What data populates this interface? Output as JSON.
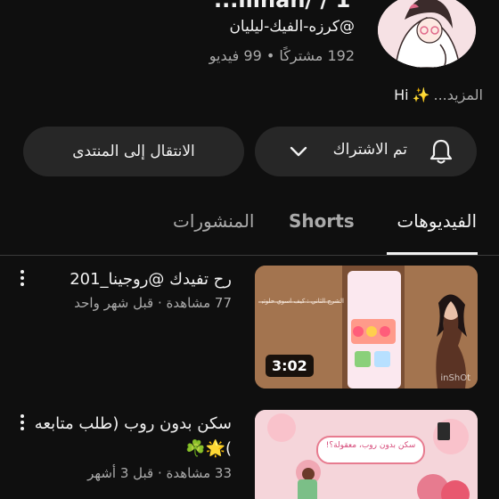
{
  "channel": {
    "name_clipped": "...iiinan/ / 1",
    "handle": "@كرزه-الفيك-ليليان",
    "stats": "192 مشتركًا • 99 فيديو",
    "description_text": "Hi",
    "description_emoji": "✨",
    "description_more": "المزيد..."
  },
  "buttons": {
    "subscribed_label": "تم الاشتراك",
    "forum_label": "الانتقال إلى المنتدى"
  },
  "tabs": {
    "videos": "الفيديوهات",
    "shorts": "Shorts",
    "posts": "المنشورات"
  },
  "videos": [
    {
      "title": "رح تفيدك @روجينا_201",
      "meta": "77 مشاهدة · قبل شهر واحد",
      "duration": "3:02",
      "thumb_caption": "الشرح الثاني : كيف اسوي حلوتي",
      "thumb_watermark": "inShOt"
    },
    {
      "title": "سكن بدون روب (طلب متابعه )🌟☘️",
      "meta": "33 مشاهدة · قبل 3 أشهر",
      "thumb_caption": "سكن بدون روب، معقولة؟!"
    }
  ],
  "colors": {
    "background": "#0f0f0f",
    "button_bg": "#272727",
    "text_primary": "#f1f1f1",
    "text_secondary": "#aaaaaa"
  }
}
